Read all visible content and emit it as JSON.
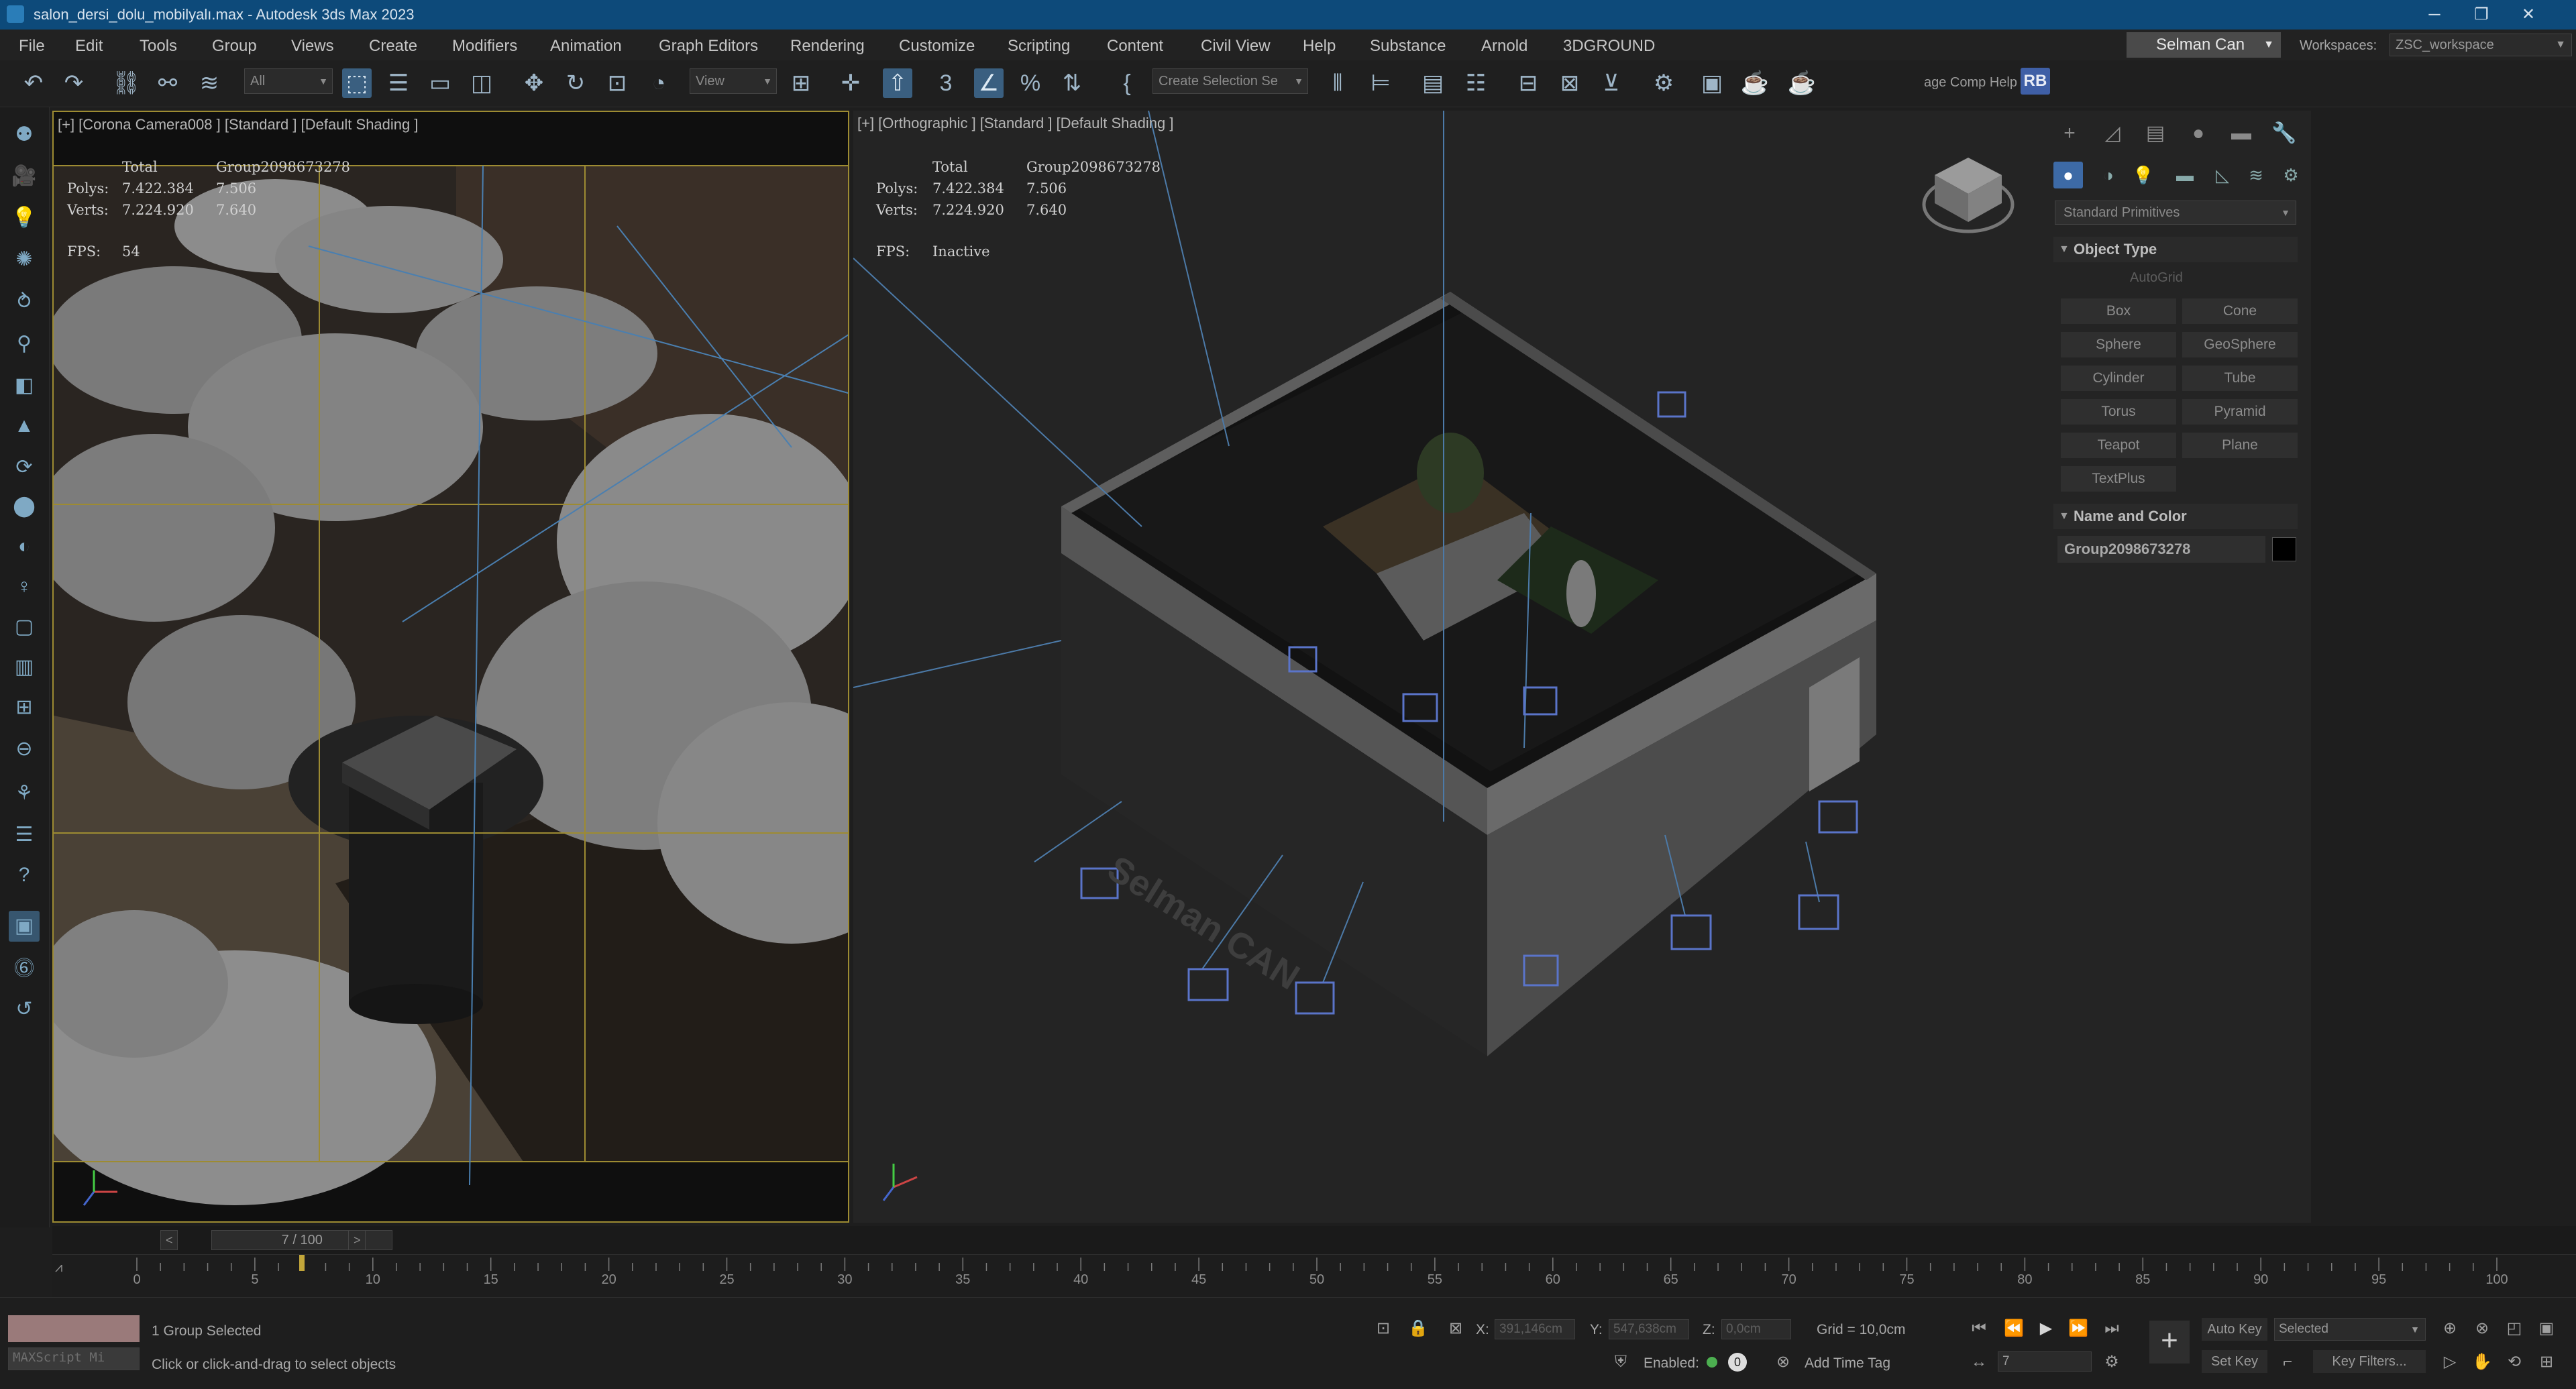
{
  "window": {
    "title": "salon_dersi_dolu_mobilyalı.max - Autodesk 3ds Max 2023",
    "minimize": "─",
    "maximize": "❐",
    "close": "✕"
  },
  "menu": {
    "items": [
      "File",
      "Edit",
      "Tools",
      "Group",
      "Views",
      "Create",
      "Modifiers",
      "Animation",
      "Graph Editors",
      "Rendering",
      "Customize",
      "Scripting",
      "Content",
      "Civil View",
      "Help",
      "Substance",
      "Arnold",
      "3DGROUND"
    ],
    "user": "Selman Can",
    "workspaces_label": "Workspaces:",
    "workspace": "ZSC_workspace"
  },
  "toolbar": {
    "filter": "All",
    "view": "View",
    "selection_set": "Create Selection Se",
    "comp_help": "age Comp Help",
    "rb": "RB"
  },
  "viewport_left": {
    "label": "[+] [Corona Camera008 ] [Standard ] [Default Shading ]",
    "stats": {
      "total_label": "Total",
      "group": "Group2098673278",
      "polys_label": "Polys:",
      "polys_total": "7.422.384",
      "polys_group": "7.506",
      "verts_label": "Verts:",
      "verts_total": "7.224.920",
      "verts_group": "7.640",
      "fps_label": "FPS:",
      "fps": "54"
    }
  },
  "viewport_right": {
    "label": "[+] [Orthographic ] [Standard ] [Default Shading ]",
    "stats": {
      "total_label": "Total",
      "group": "Group2098673278",
      "polys_label": "Polys:",
      "polys_total": "7.422.384",
      "polys_group": "7.506",
      "verts_label": "Verts:",
      "verts_total": "7.224.920",
      "verts_group": "7.640",
      "fps_label": "FPS:",
      "fps": "Inactive"
    },
    "watermark": "Selman CAN"
  },
  "command_panel": {
    "category": "Standard Primitives",
    "object_type_header": "Object Type",
    "autogrid": "AutoGrid",
    "buttons": [
      "Box",
      "Cone",
      "Sphere",
      "GeoSphere",
      "Cylinder",
      "Tube",
      "Torus",
      "Pyramid",
      "Teapot",
      "Plane",
      "TextPlus"
    ],
    "name_color_header": "Name and Color",
    "object_name": "Group2098673278",
    "object_color": "#000000"
  },
  "timeline": {
    "frame_display": "7 / 100",
    "prev": "<",
    "next": ">",
    "current_frame": 7,
    "total_frames": 100,
    "ticks": [
      "0",
      "5",
      "10",
      "15",
      "20",
      "25",
      "30",
      "35",
      "40",
      "45",
      "50",
      "55",
      "60",
      "65",
      "70",
      "75",
      "80",
      "85",
      "90",
      "95",
      "100"
    ]
  },
  "status": {
    "maxscript": "MAXScript Mi",
    "selection": "1 Group Selected",
    "prompt": "Click or click-and-drag to select objects",
    "x_label": "X:",
    "x_value": "391,146cm",
    "y_label": "Y:",
    "y_value": "547,638cm",
    "z_label": "Z:",
    "z_value": "0,0cm",
    "grid": "Grid = 10,0cm",
    "enabled_label": "Enabled:",
    "add_time_tag": "Add Time Tag",
    "auto_key": "Auto Key",
    "set_key": "Set Key",
    "selected": "Selected",
    "key_filters": "Key Filters...",
    "frame_field": "7"
  },
  "colors": {
    "titlebar": "#0d4a7a",
    "viewport_border": "#9d8b32",
    "active_button": "#3d6aa6",
    "gizmo_blue": "#5a74c9"
  }
}
